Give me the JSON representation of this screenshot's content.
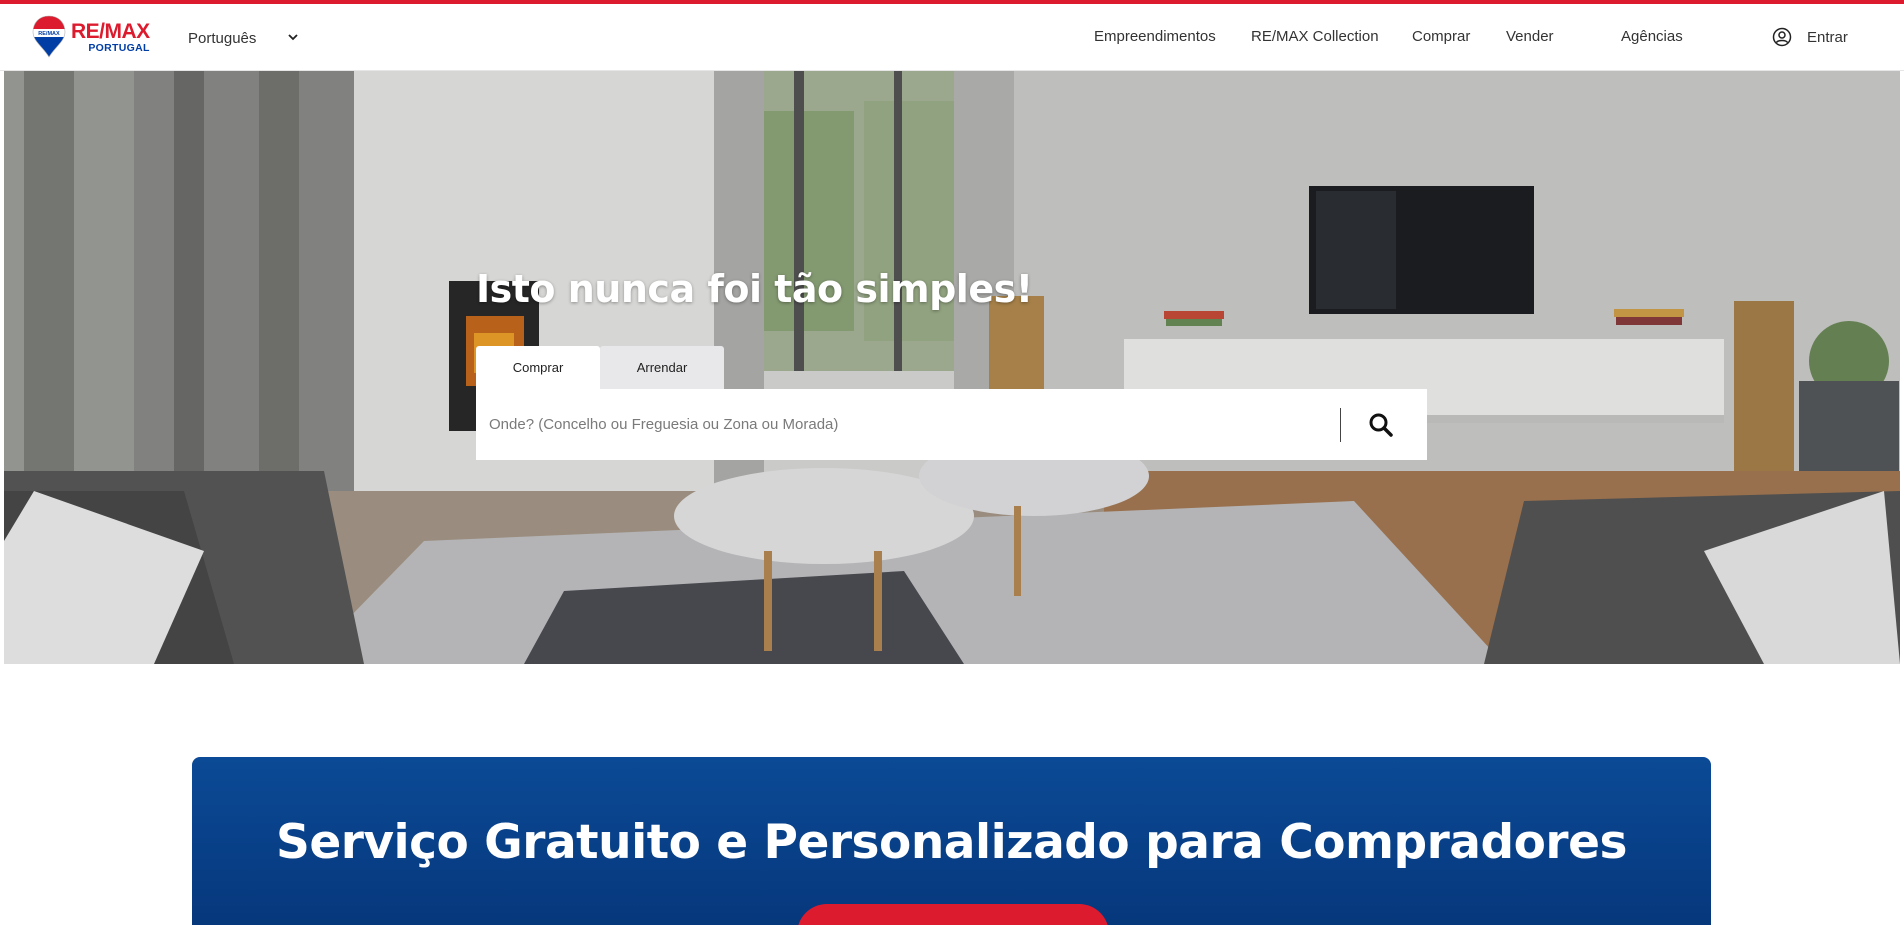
{
  "brand": {
    "primary": "RE/MAX",
    "secondary": "PORTUGAL",
    "red": "#dc1c2e",
    "blue": "#003da5"
  },
  "header": {
    "language": {
      "label": "Português",
      "icon": "chevron-down-icon"
    },
    "nav": [
      {
        "label": "Empreendimentos"
      },
      {
        "label": "RE/MAX Collection"
      },
      {
        "label": "Comprar"
      },
      {
        "label": "Vender"
      },
      {
        "label": "Agências"
      }
    ],
    "login": {
      "label": "Entrar",
      "icon": "user-circle-icon"
    }
  },
  "hero": {
    "title": "Isto nunca foi tão simples!",
    "tabs": [
      {
        "label": "Comprar",
        "active": true
      },
      {
        "label": "Arrendar",
        "active": false
      }
    ],
    "search": {
      "placeholder": "Onde? (Concelho ou Freguesia ou Zona ou Morada)",
      "value": "",
      "icon": "search-icon"
    }
  },
  "services_banner": {
    "title": "Serviço Gratuito e Personalizado para Compradores",
    "background": "#0b4a96"
  }
}
